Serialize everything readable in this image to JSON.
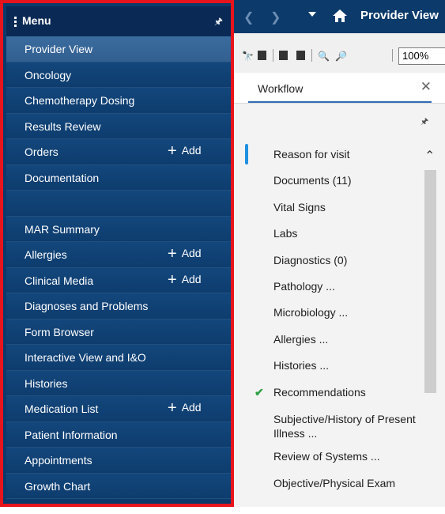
{
  "menu": {
    "title": "Menu",
    "add_label": "Add",
    "items": [
      {
        "label": "Provider View",
        "add": false,
        "active": true
      },
      {
        "label": "Oncology",
        "add": false
      },
      {
        "label": "Chemotherapy Dosing",
        "add": false
      },
      {
        "label": "Results Review",
        "add": false
      },
      {
        "label": "Orders",
        "add": true
      },
      {
        "label": "Documentation",
        "add": false
      },
      {
        "label": "",
        "add": false
      },
      {
        "label": "MAR Summary",
        "add": false
      },
      {
        "label": "Allergies",
        "add": true
      },
      {
        "label": "Clinical Media",
        "add": true
      },
      {
        "label": "Diagnoses and Problems",
        "add": false
      },
      {
        "label": "Form Browser",
        "add": false
      },
      {
        "label": "Interactive View and I&O",
        "add": false
      },
      {
        "label": "Histories",
        "add": false
      },
      {
        "label": "Medication List",
        "add": true
      },
      {
        "label": "Patient Information",
        "add": false
      },
      {
        "label": "Appointments",
        "add": false
      },
      {
        "label": "Growth Chart",
        "add": false
      }
    ]
  },
  "topbar": {
    "title": "Provider View"
  },
  "toolbar": {
    "zoom_value": "100%"
  },
  "tabs": {
    "workflow_label": "Workflow"
  },
  "workflow": {
    "items": [
      {
        "label": "Reason for visit"
      },
      {
        "label": "Documents (11)"
      },
      {
        "label": "Vital Signs"
      },
      {
        "label": "Labs"
      },
      {
        "label": "Diagnostics (0)"
      },
      {
        "label": "Pathology ..."
      },
      {
        "label": "Microbiology ..."
      },
      {
        "label": "Allergies ..."
      },
      {
        "label": "Histories ..."
      },
      {
        "label": "Recommendations",
        "checked": true
      },
      {
        "label": "Subjective/History of Present Illness ...",
        "wrap": true
      },
      {
        "label": "Review of Systems ..."
      },
      {
        "label": "Objective/Physical Exam",
        "wrap": true
      }
    ]
  },
  "colors": {
    "menu_bg": "#0c3a6b",
    "highlight_border": "#e8141c",
    "accent": "#1f8fe0",
    "check": "#2ea043"
  }
}
